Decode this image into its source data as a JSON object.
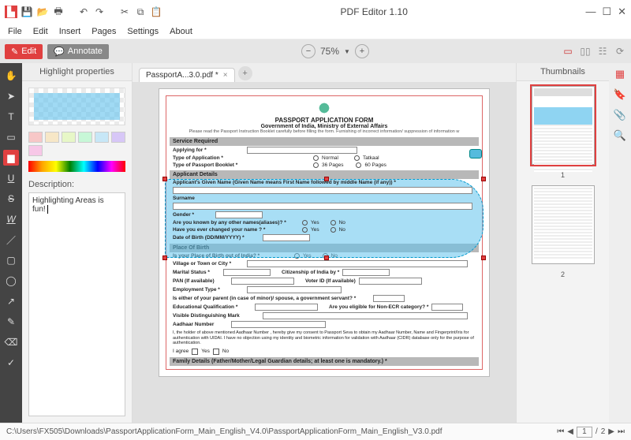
{
  "titlebar": {
    "title": "PDF Editor 1.10"
  },
  "menubar": [
    "File",
    "Edit",
    "Insert",
    "Pages",
    "Settings",
    "About"
  ],
  "modebar": {
    "edit": "Edit",
    "annotate": "Annotate",
    "zoom": "75%"
  },
  "left": {
    "title": "Highlight properties",
    "swatches": [
      "#f7c7c7",
      "#f7e7c7",
      "#e7f7c7",
      "#c7f7d7",
      "#c7e7f7",
      "#d7c7f7",
      "#f7c7e7"
    ],
    "descLabel": "Description:",
    "descValue": "Highlighting Areas is fun!"
  },
  "tab": {
    "name": "PassportA...3.0.pdf *"
  },
  "form": {
    "h1": "PASSPORT APPLICATION FORM",
    "h2": "Government of India, Ministry of External Affairs",
    "note": "Please read the Passport Instruction Booklet carefully before filling the form. Furnishing of incorrect information/ suppression of information w",
    "sec_service": "Service Required",
    "applying_for": "Applying for *",
    "type_app": "Type of Application *",
    "normal": "Normal",
    "tatkaal": "Tatkaal",
    "type_booklet": "Type of Passport Booklet *",
    "p36": "36 Pages",
    "p60": "60 Pages",
    "sec_applicant": "Applicant Details",
    "given_name": "Applicant's Given Name (Given Name means First Name followed by middle Name (if any)) *",
    "surname": "Surname",
    "gender": "Gender *",
    "aliases": "Are you known by any other names(aliases)? *",
    "changed": "Have you ever changed your name ? *",
    "yes": "Yes",
    "no": "No",
    "dob": "Date of Birth (DD/MM/YYYY) *",
    "sec_place": "Place Of Birth",
    "pob_out": "Is your Place of Birth out of India? *",
    "village": "Village or Town or City *",
    "marital": "Marital Status *",
    "citizenship": "Citizenship of India by *",
    "pan": "PAN (If available)",
    "voter": "Voter ID (If available)",
    "employment": "Employment Type *",
    "parent_gov": "Is either of your parent (in case of minor)/ spouse, a government servant? *",
    "edu": "Educational Qualification *",
    "non_ecr": "Are you eligible for Non-ECR category? *",
    "marks": "Visible Distinguishing Mark",
    "aadhaar": "Aadhaar Number",
    "consent": "I, the holder of above mentioned Aadhaar Number , hereby give my consent to Passport Seva to obtain my Aadhaar Number, Name and Fingerprint/Iris for authentication with UIDAI. I have no objection using my identity and biometric information for validation with Aadhaar (CIDR) database only for the purpose of authentication.",
    "agree": "I agree",
    "sec_family": "Family Details (Father/Mother/Legal Guardian details; at least one is mandatory.) *"
  },
  "right": {
    "title": "Thumbnails",
    "p1": "1",
    "p2": "2"
  },
  "status": {
    "path": "C:\\Users\\FX505\\Downloads\\PassportApplicationForm_Main_English_V4.0\\PassportApplicationForm_Main_English_V3.0.pdf",
    "page": "1",
    "sep": "/",
    "total": "2"
  }
}
